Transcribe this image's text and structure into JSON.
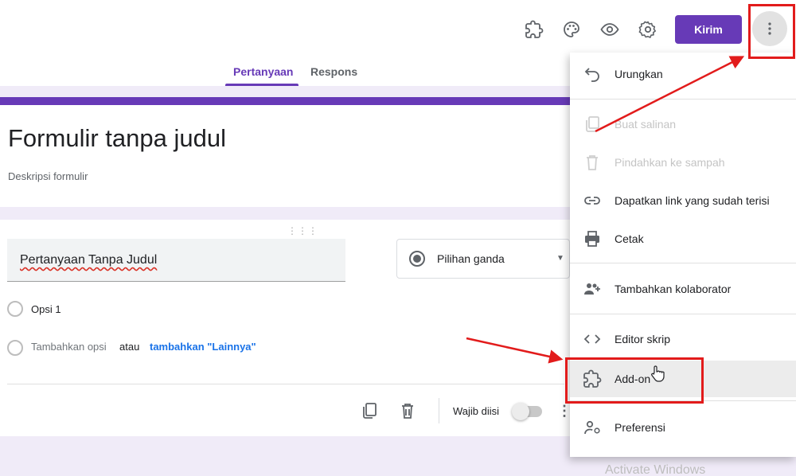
{
  "header": {
    "icons": [
      "puzzle-icon",
      "palette-icon",
      "eye-icon",
      "gear-icon"
    ],
    "send_label": "Kirim",
    "more_icon": "vertical-dots-icon"
  },
  "tabs": [
    {
      "label": "Pertanyaan",
      "active": true
    },
    {
      "label": "Respons",
      "active": false
    }
  ],
  "form": {
    "title": "Formulir tanpa judul",
    "description": "Deskripsi formulir"
  },
  "question": {
    "title": "Pertanyaan Tanpa Judul",
    "type_label": "Pilihan ganda",
    "option_1": "Opsi 1",
    "add_option": "Tambahkan opsi",
    "or": "atau",
    "add_other": "tambahkan \"Lainnya\"",
    "required_label": "Wajib diisi"
  },
  "menu": {
    "items": [
      {
        "label": "Urungkan",
        "icon": "undo-icon",
        "disabled": false
      },
      {
        "label": "Buat salinan",
        "icon": "copy-icon",
        "disabled": true
      },
      {
        "label": "Pindahkan ke sampah",
        "icon": "trash-icon",
        "disabled": true
      },
      {
        "label": "Dapatkan link yang sudah terisi",
        "icon": "link-icon",
        "disabled": false
      },
      {
        "label": "Cetak",
        "icon": "print-icon",
        "disabled": false
      },
      {
        "label": "Tambahkan kolaborator",
        "icon": "add-people-icon",
        "disabled": false
      },
      {
        "label": "Editor skrip",
        "icon": "code-icon",
        "disabled": false
      },
      {
        "label": "Add-on",
        "icon": "puzzle-icon",
        "disabled": false,
        "hovered": true
      },
      {
        "label": "Preferensi",
        "icon": "person-settings-icon",
        "disabled": false
      }
    ]
  },
  "colors": {
    "accent": "#673ab7",
    "annotation": "#e21b1b",
    "background": "#f0ebf8",
    "link": "#1a73e8"
  },
  "watermark": "Activate Windows"
}
